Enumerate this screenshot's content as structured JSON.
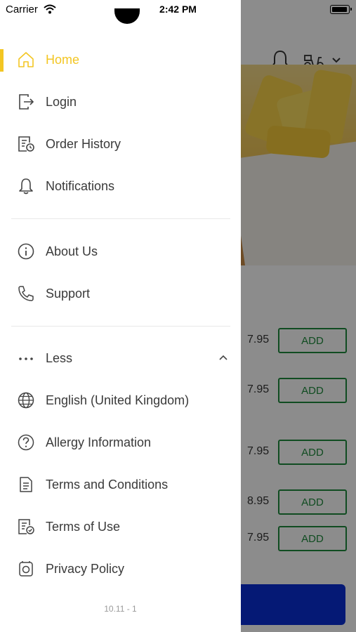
{
  "status_bar": {
    "carrier": "Carrier",
    "time": "2:42 PM"
  },
  "background": {
    "items": [
      {
        "price": "7.95",
        "button": "ADD"
      },
      {
        "price": "7.95",
        "button": "ADD"
      },
      {
        "price": "7.95",
        "button": "ADD"
      },
      {
        "price": "8.95",
        "button": "ADD"
      },
      {
        "price": "7.95",
        "button": "ADD"
      }
    ]
  },
  "drawer": {
    "accent_color": "#f3c623",
    "primary_items": [
      {
        "label": "Home",
        "icon": "home-icon",
        "active": true
      },
      {
        "label": "Login",
        "icon": "login-icon"
      },
      {
        "label": "Order History",
        "icon": "order-history-icon"
      },
      {
        "label": "Notifications",
        "icon": "bell-icon"
      }
    ],
    "secondary_items": [
      {
        "label": "About Us",
        "icon": "info-icon"
      },
      {
        "label": "Support",
        "icon": "phone-icon"
      }
    ],
    "more_toggle": {
      "label": "Less",
      "icon": "more-dots-icon"
    },
    "extra_items": [
      {
        "label": "English (United Kingdom)",
        "icon": "globe-icon"
      },
      {
        "label": "Allergy Information",
        "icon": "question-icon"
      },
      {
        "label": "Terms and Conditions",
        "icon": "document-icon"
      },
      {
        "label": "Terms of Use",
        "icon": "document-check-icon"
      },
      {
        "label": "Privacy Policy",
        "icon": "privacy-icon"
      }
    ],
    "version": "10.11 - 1"
  }
}
